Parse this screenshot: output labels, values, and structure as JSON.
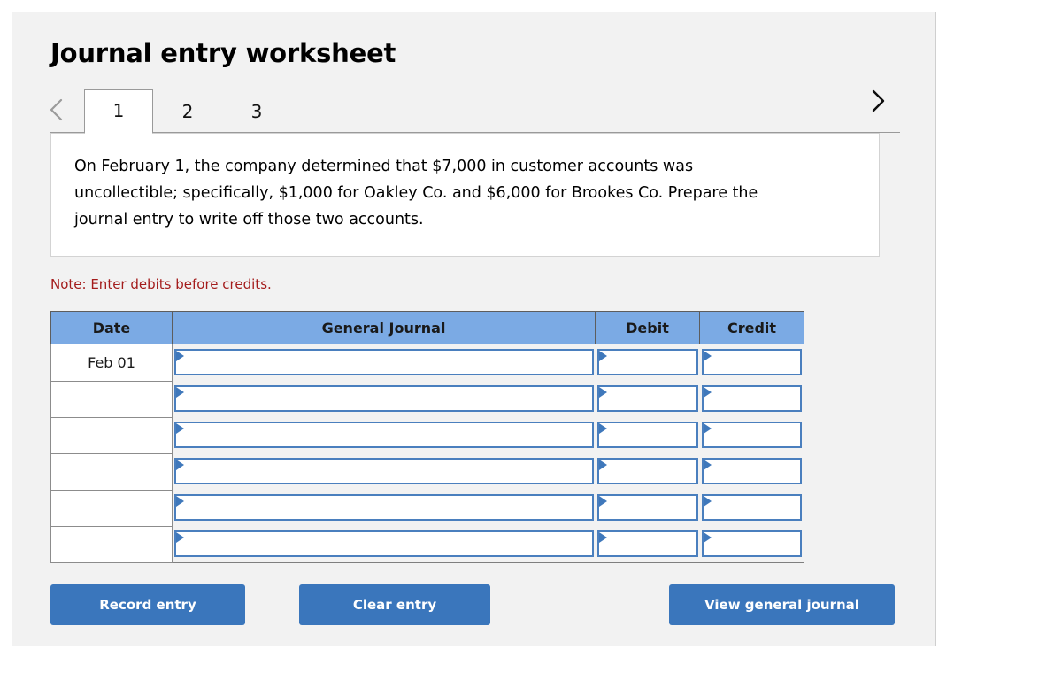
{
  "header": {
    "title": "Journal entry worksheet"
  },
  "tabs": {
    "prev_icon": "chevron-left-icon",
    "next_icon": "chevron-right-icon",
    "items": [
      {
        "label": "1",
        "active": true
      },
      {
        "label": "2",
        "active": false
      },
      {
        "label": "3",
        "active": false
      }
    ]
  },
  "question": {
    "text": "On February 1, the company determined that $7,000 in customer accounts was uncollectible; specifically, $1,000 for Oakley Co. and $6,000 for Brookes Co. Prepare the journal entry to write off those two accounts."
  },
  "note": {
    "text": "Note: Enter debits before credits."
  },
  "table": {
    "columns": [
      "Date",
      "General Journal",
      "Debit",
      "Credit"
    ],
    "rows": [
      {
        "date": "Feb 01",
        "general_journal": "",
        "debit": "",
        "credit": ""
      },
      {
        "date": "",
        "general_journal": "",
        "debit": "",
        "credit": ""
      },
      {
        "date": "",
        "general_journal": "",
        "debit": "",
        "credit": ""
      },
      {
        "date": "",
        "general_journal": "",
        "debit": "",
        "credit": ""
      },
      {
        "date": "",
        "general_journal": "",
        "debit": "",
        "credit": ""
      },
      {
        "date": "",
        "general_journal": "",
        "debit": "",
        "credit": ""
      }
    ]
  },
  "buttons": {
    "record": "Record entry",
    "clear": "Clear entry",
    "view": "View general journal"
  },
  "colors": {
    "header_blue": "#7baae4",
    "button_blue": "#3a76bc",
    "input_border_blue": "#4a7fbe",
    "note_red": "#a41c1c",
    "card_bg": "#f2f2f2"
  }
}
